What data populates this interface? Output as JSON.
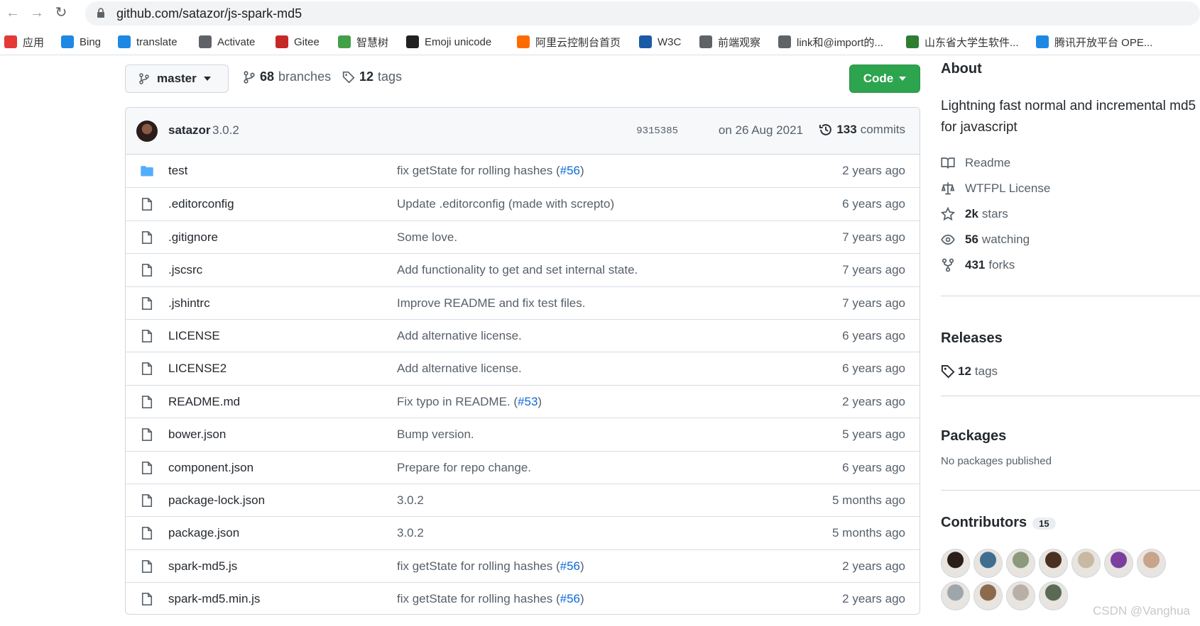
{
  "browser": {
    "url": "github.com/satazor/js-spark-md5",
    "bookmarks": [
      {
        "label": "应用",
        "icon": "apps-grid-icon",
        "color": "#e53935"
      },
      {
        "label": "Bing",
        "icon": "bing-icon",
        "color": "#1e88e5"
      },
      {
        "label": "translate",
        "icon": "translate-icon",
        "color": "#1e88e5"
      },
      {
        "label": "Activate",
        "icon": "globe-icon",
        "color": "#5f6368"
      },
      {
        "label": "Gitee",
        "icon": "gitee-icon",
        "color": "#c62828"
      },
      {
        "label": "智慧树",
        "icon": "zhihuishu-icon",
        "color": "#43a047"
      },
      {
        "label": "Emoji unicode",
        "icon": "emoji-unicode-icon",
        "color": "#212121"
      },
      {
        "label": "阿里云控制台首页",
        "icon": "aliyun-icon",
        "color": "#ff6a00"
      },
      {
        "label": "W3C",
        "icon": "w3c-icon",
        "color": "#1a5aa6"
      },
      {
        "label": "前端观察",
        "icon": "globe-icon",
        "color": "#5f6368"
      },
      {
        "label": "link和@import的...",
        "icon": "bookmark-icon",
        "color": "#5f6368"
      },
      {
        "label": "山东省大学生软件...",
        "icon": "sdu-icon",
        "color": "#2e7d32"
      },
      {
        "label": "腾讯开放平台 OPE...",
        "icon": "tencent-icon",
        "color": "#1e88e5"
      }
    ]
  },
  "toolbar": {
    "branch": "master",
    "branches_count": "68",
    "branches_label": "branches",
    "tags_count": "12",
    "tags_label": "tags",
    "code_label": "Code"
  },
  "latest_commit": {
    "author": "satazor",
    "message": "3.0.2",
    "sha": "9315385",
    "date": "on 26 Aug 2021",
    "commits_count": "133",
    "commits_label": "commits"
  },
  "files": [
    {
      "type": "folder",
      "name": "test",
      "message": "fix getState for rolling hashes (",
      "issue": "#56",
      "suffix": ")",
      "age": "2 years ago"
    },
    {
      "type": "file",
      "name": ".editorconfig",
      "message": "Update .editorconfig (made with screpto)",
      "issue": "",
      "suffix": "",
      "age": "6 years ago"
    },
    {
      "type": "file",
      "name": ".gitignore",
      "message": "Some love.",
      "issue": "",
      "suffix": "",
      "age": "7 years ago"
    },
    {
      "type": "file",
      "name": ".jscsrc",
      "message": "Add functionality to get and set internal state.",
      "issue": "",
      "suffix": "",
      "age": "7 years ago"
    },
    {
      "type": "file",
      "name": ".jshintrc",
      "message": "Improve README and fix test files.",
      "issue": "",
      "suffix": "",
      "age": "7 years ago"
    },
    {
      "type": "file",
      "name": "LICENSE",
      "message": "Add alternative license.",
      "issue": "",
      "suffix": "",
      "age": "6 years ago"
    },
    {
      "type": "file",
      "name": "LICENSE2",
      "message": "Add alternative license.",
      "issue": "",
      "suffix": "",
      "age": "6 years ago"
    },
    {
      "type": "file",
      "name": "README.md",
      "message": "Fix typo in README. (",
      "issue": "#53",
      "suffix": ")",
      "age": "2 years ago"
    },
    {
      "type": "file",
      "name": "bower.json",
      "message": "Bump version.",
      "issue": "",
      "suffix": "",
      "age": "5 years ago"
    },
    {
      "type": "file",
      "name": "component.json",
      "message": "Prepare for repo change.",
      "issue": "",
      "suffix": "",
      "age": "6 years ago"
    },
    {
      "type": "file",
      "name": "package-lock.json",
      "message": "3.0.2",
      "issue": "",
      "suffix": "",
      "age": "5 months ago"
    },
    {
      "type": "file",
      "name": "package.json",
      "message": "3.0.2",
      "issue": "",
      "suffix": "",
      "age": "5 months ago"
    },
    {
      "type": "file",
      "name": "spark-md5.js",
      "message": "fix getState for rolling hashes (",
      "issue": "#56",
      "suffix": ")",
      "age": "2 years ago"
    },
    {
      "type": "file",
      "name": "spark-md5.min.js",
      "message": "fix getState for rolling hashes (",
      "issue": "#56",
      "suffix": ")",
      "age": "2 years ago"
    }
  ],
  "sidebar": {
    "about_title": "About",
    "description": "Lightning fast normal and incremental md5 for javascript",
    "readme": "Readme",
    "license": "WTFPL License",
    "stars_count": "2k",
    "stars_label": "stars",
    "watching_count": "56",
    "watching_label": "watching",
    "forks_count": "431",
    "forks_label": "forks",
    "releases_title": "Releases",
    "release_tags_count": "12",
    "release_tags_label": "tags",
    "packages_title": "Packages",
    "packages_text": "No packages published",
    "contributors_title": "Contributors",
    "contributors_count": "15",
    "contributor_colors": [
      "#2b1d1a",
      "#3f6e8f",
      "#8a9a7a",
      "#4a3020",
      "#c9b8a2",
      "#7b3fa0",
      "#c8a48a",
      "#9ea6ad",
      "#8c6a4e",
      "#b8b0a8",
      "#5a6a55"
    ]
  },
  "watermark": "CSDN @Vanghua"
}
